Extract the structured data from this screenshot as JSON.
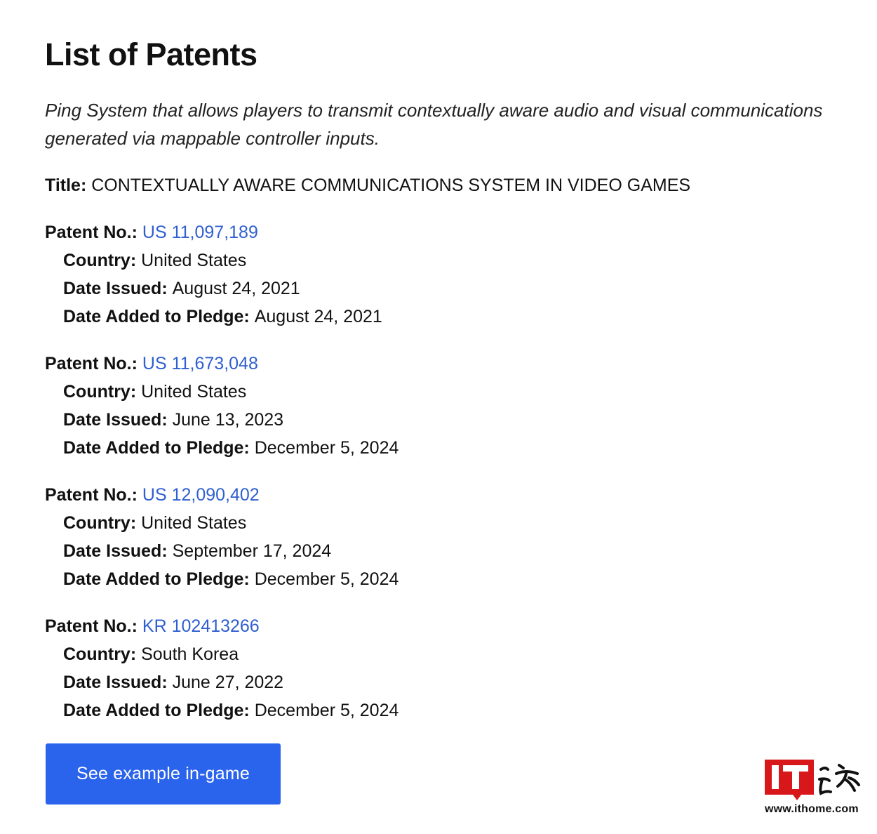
{
  "page": {
    "heading": "List of Patents",
    "summary": "Ping System that allows players to transmit contextually aware audio and visual communications generated via mappable controller inputs.",
    "title_label": "Title:",
    "title_value": "CONTEXTUALLY AWARE COMMUNICATIONS SYSTEM IN VIDEO GAMES"
  },
  "labels": {
    "patent_no": "Patent No.:",
    "country": "Country:",
    "date_issued": "Date Issued:",
    "date_added": "Date Added to Pledge:"
  },
  "patents": [
    {
      "number": "US 11,097,189",
      "country": "United States",
      "date_issued": "August 24, 2021",
      "date_added": "August 24, 2021"
    },
    {
      "number": "US 11,673,048",
      "country": "United States",
      "date_issued": "June 13, 2023",
      "date_added": "December 5, 2024"
    },
    {
      "number": "US 12,090,402",
      "country": "United States",
      "date_issued": "September 17, 2024",
      "date_added": "December 5, 2024"
    },
    {
      "number": "KR 102413266",
      "country": "South Korea",
      "date_issued": "June 27, 2022",
      "date_added": "December 5, 2024"
    }
  ],
  "cta": {
    "label": "See example in-game"
  },
  "watermark": {
    "logo_text": "IT之家",
    "url": "www.ithome.com"
  },
  "colors": {
    "link": "#2f5fd0",
    "button": "#2a63ec",
    "watermark_red": "#d8171a"
  }
}
